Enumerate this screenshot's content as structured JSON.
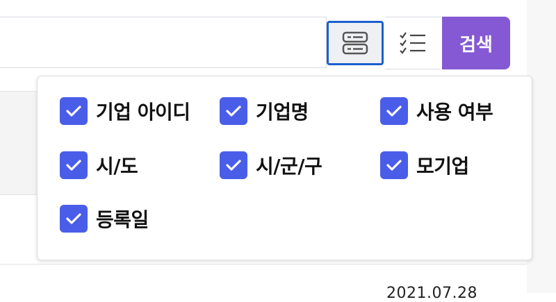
{
  "toolbar": {
    "search_button_label": "검색",
    "view_toggle_icon": "server-list-icon",
    "column_toggle_icon": "checklist-icon"
  },
  "column_menu": {
    "accent_color": "#4a5de8",
    "options": [
      {
        "label": "기업 아이디",
        "checked": true
      },
      {
        "label": "기업명",
        "checked": true
      },
      {
        "label": "사용 여부",
        "checked": true
      },
      {
        "label": "시/도",
        "checked": true
      },
      {
        "label": "시/군/구",
        "checked": true
      },
      {
        "label": "모기업",
        "checked": true
      },
      {
        "label": "등록일",
        "checked": true
      }
    ]
  },
  "background_table": {
    "partial_date": "2021.07.28"
  }
}
